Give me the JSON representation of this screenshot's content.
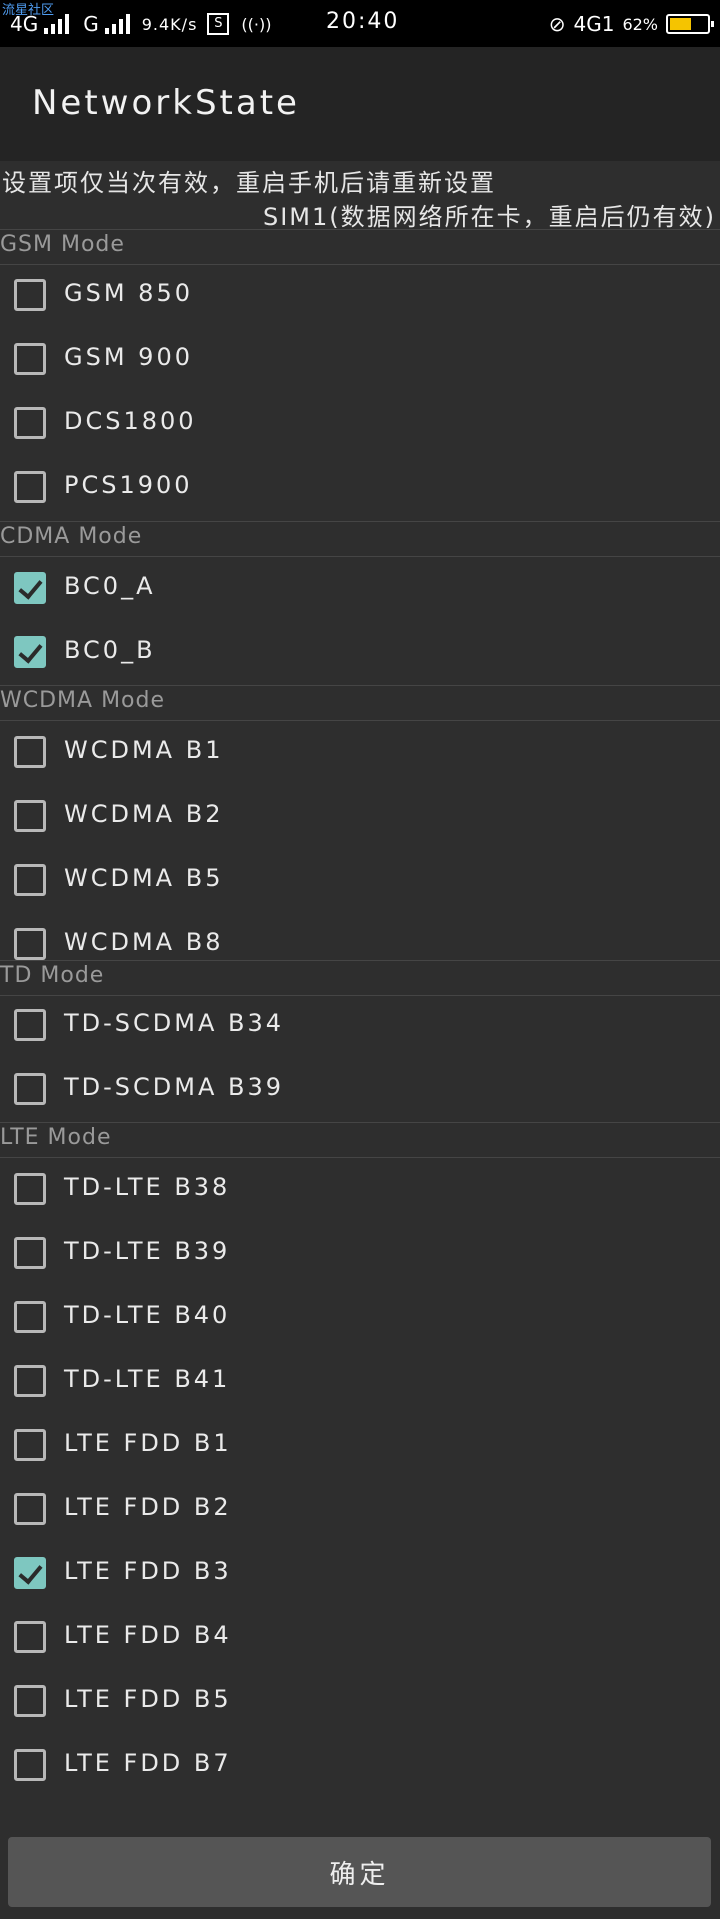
{
  "status": {
    "carrier_tag": "流星社区",
    "net1": "4G",
    "net2": "G",
    "speed": "9.4K/s",
    "time": "20:40",
    "net_right": "4G1",
    "battery_pct": "62%",
    "battery_level": 0.62,
    "battery_color": "#f5c400"
  },
  "app": {
    "title": "NetworkState"
  },
  "notice": {
    "line1": "设置项仅当次有效，重启手机后请重新设置",
    "line2": "SIM1(数据网络所在卡，重启后仍有效)"
  },
  "sections": {
    "gsm": "GSM Mode",
    "cdma": "CDMA Mode",
    "wcdma": "WCDMA Mode",
    "td": "TD Mode",
    "lte": "LTE Mode"
  },
  "gsm": [
    {
      "label": "GSM 850",
      "checked": false
    },
    {
      "label": "GSM 900",
      "checked": false
    },
    {
      "label": "DCS1800",
      "checked": false
    },
    {
      "label": "PCS1900",
      "checked": false
    }
  ],
  "cdma": [
    {
      "label": "BC0_A",
      "checked": true
    },
    {
      "label": "BC0_B",
      "checked": true
    }
  ],
  "wcdma": [
    {
      "label": "WCDMA B1",
      "checked": false
    },
    {
      "label": "WCDMA B2",
      "checked": false
    },
    {
      "label": "WCDMA B5",
      "checked": false
    },
    {
      "label": "WCDMA B8",
      "checked": false
    }
  ],
  "td": [
    {
      "label": "TD-SCDMA B34",
      "checked": false
    },
    {
      "label": "TD-SCDMA B39",
      "checked": false
    }
  ],
  "lte": [
    {
      "label": "TD-LTE B38",
      "checked": false
    },
    {
      "label": "TD-LTE B39",
      "checked": false
    },
    {
      "label": "TD-LTE B40",
      "checked": false
    },
    {
      "label": "TD-LTE B41",
      "checked": false
    },
    {
      "label": "LTE FDD B1",
      "checked": false
    },
    {
      "label": "LTE FDD B2",
      "checked": false
    },
    {
      "label": "LTE FDD B3",
      "checked": true
    },
    {
      "label": "LTE FDD B4",
      "checked": false
    },
    {
      "label": "LTE FDD B5",
      "checked": false
    },
    {
      "label": "LTE FDD B7",
      "checked": false
    }
  ],
  "confirm_label": "确定",
  "accent": "#7ec7c0"
}
